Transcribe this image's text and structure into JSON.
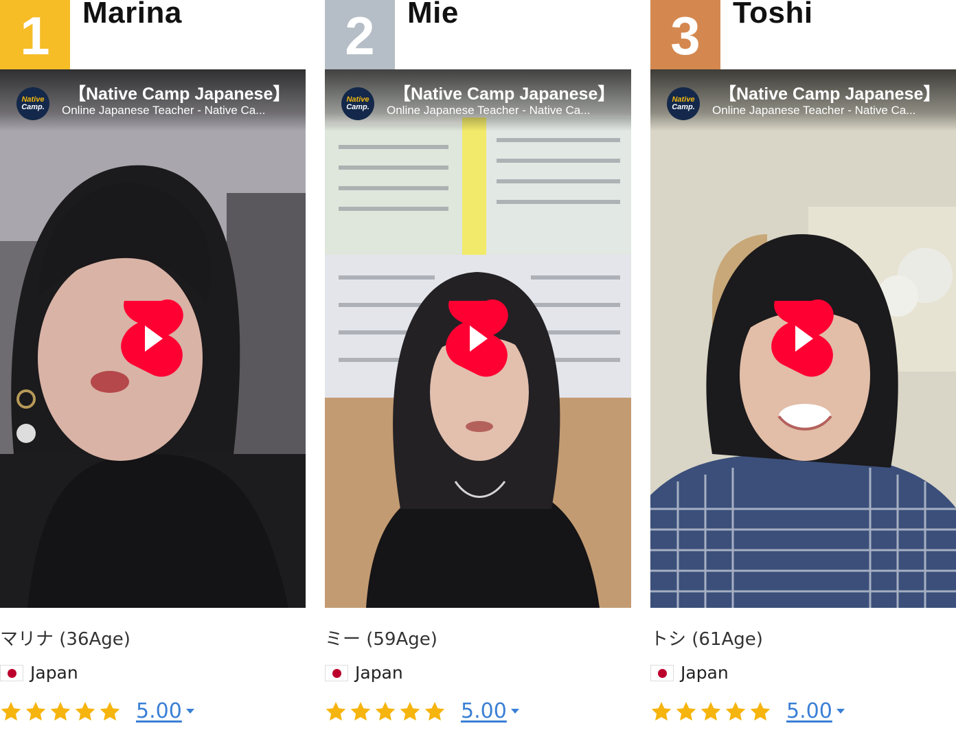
{
  "colors": {
    "rank_gold": "#f6bd27",
    "rank_silver": "#b5bec7",
    "rank_bronze": "#d4884f",
    "star": "#f6b40e",
    "link": "#3a7fd5",
    "play_red": "#ff0033"
  },
  "video": {
    "channel_logo_line1": "Native",
    "channel_logo_line2": "Camp.",
    "title": "【Native Camp Japanese】",
    "subtitle": "Online Japanese Teacher - Native Ca..."
  },
  "teachers": [
    {
      "rank": "1",
      "name": "Marina",
      "meta": "マリナ (36Age)",
      "country": "Japan",
      "rating": "5.00",
      "stars": 5
    },
    {
      "rank": "2",
      "name": "Mie",
      "meta": "ミー (59Age)",
      "country": "Japan",
      "rating": "5.00",
      "stars": 5
    },
    {
      "rank": "3",
      "name": "Toshi",
      "meta": "トシ (61Age)",
      "country": "Japan",
      "rating": "5.00",
      "stars": 5
    }
  ]
}
